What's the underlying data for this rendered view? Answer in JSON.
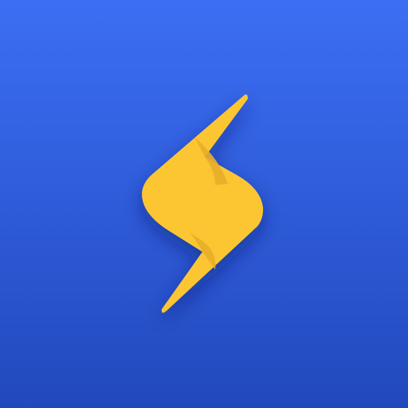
{
  "app_icon": {
    "icon": "lightning-bolt-icon",
    "colors": {
      "background_top": "#3C6EF4",
      "background_bottom": "#2149BD",
      "bolt": "#FCC630",
      "bolt_shade": "#E9AD2A"
    }
  }
}
